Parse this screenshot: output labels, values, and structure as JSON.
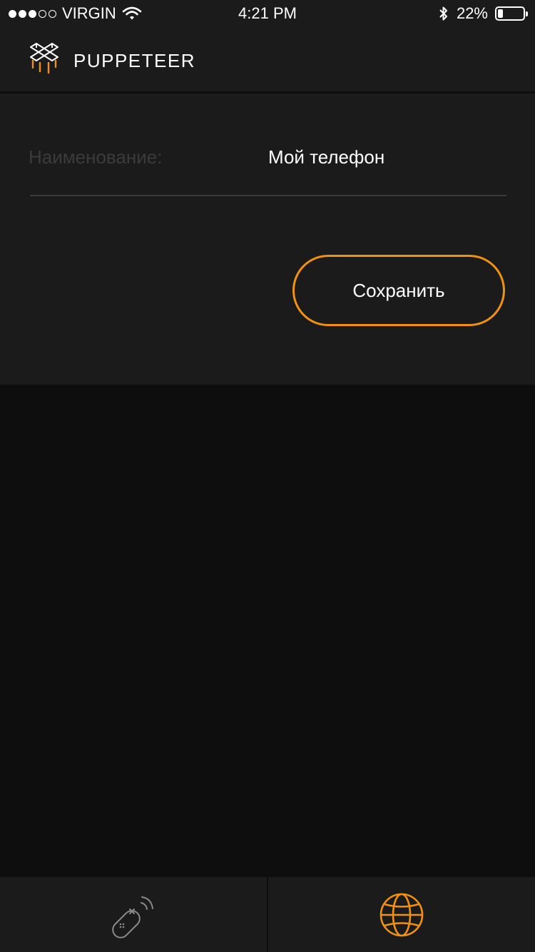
{
  "status_bar": {
    "carrier": "VIRGIN",
    "time": "4:21 PM",
    "battery_percent": "22%",
    "battery_level": 0.22,
    "icons": [
      "signal-dots",
      "wifi-icon",
      "bluetooth-icon",
      "battery-icon"
    ]
  },
  "header": {
    "app_title": "PUPPETEER",
    "logo_icon": "puppeteer-logo-icon"
  },
  "form": {
    "name_label": "Наименование:",
    "name_value": "Мой телефон",
    "save_label": "Сохранить"
  },
  "tabs": [
    {
      "icon": "remote-control-icon",
      "active": false
    },
    {
      "icon": "globe-icon",
      "active": true
    }
  ],
  "colors": {
    "accent": "#f0910f",
    "panel": "#1b1b1b",
    "background": "#0e0e0e",
    "inactive_icon": "#8a8a8a"
  }
}
